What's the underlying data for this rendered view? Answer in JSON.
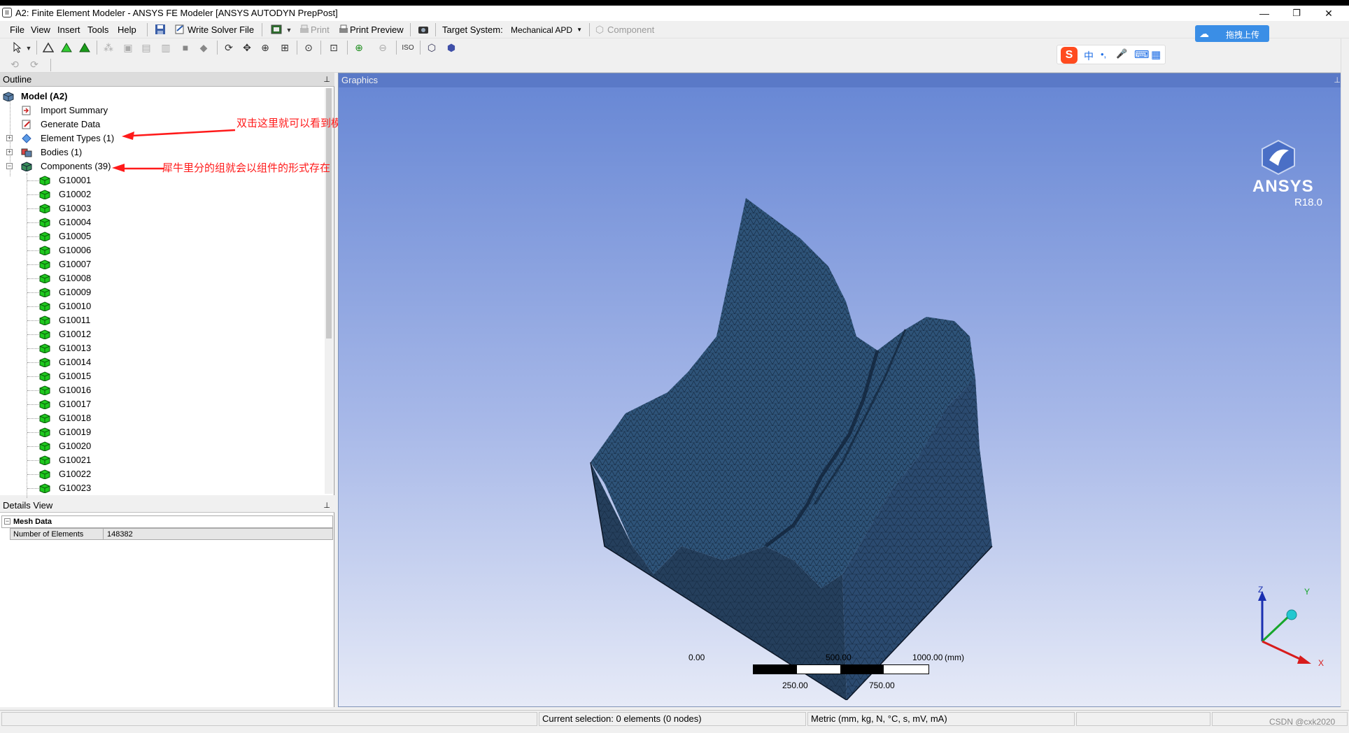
{
  "window": {
    "title": "A2: Finite Element Modeler - ANSYS FE Modeler [ANSYS AUTODYN PrepPost]",
    "app_icon": "ansys-app-icon",
    "minimize": "—",
    "restore": "❐",
    "close": "✕"
  },
  "menu": [
    "File",
    "View",
    "Insert",
    "Tools",
    "Help"
  ],
  "toolbar": {
    "write_solver_file": "Write Solver File",
    "print": "Print",
    "print_preview": "Print Preview",
    "target_system_label": "Target System:",
    "target_system_value": "Mechanical APD",
    "component": "Component"
  },
  "outline": {
    "title": "Outline",
    "pin": "⊥",
    "root": "Model (A2)",
    "items": [
      {
        "label": "Import Summary"
      },
      {
        "label": "Generate Data"
      },
      {
        "label": "Element Types (1)"
      },
      {
        "label": "Bodies (1)"
      },
      {
        "label": "Components (39)"
      }
    ],
    "components": [
      "G10001",
      "G10002",
      "G10003",
      "G10004",
      "G10005",
      "G10006",
      "G10007",
      "G10008",
      "G10009",
      "G10010",
      "G10011",
      "G10012",
      "G10013",
      "G10014",
      "G10015",
      "G10016",
      "G10017",
      "G10018",
      "G10019",
      "G10020",
      "G10021",
      "G10022",
      "G10023"
    ]
  },
  "annotations": {
    "element_types_note": "双击这里就可以看到模型",
    "components_note": "犀牛里分的组就会以组件的形式存在"
  },
  "details": {
    "title": "Details View",
    "pin": "⊥",
    "section": "Mesh Data",
    "rows": [
      {
        "name": "Number of Elements",
        "value": "148382"
      }
    ]
  },
  "graphics": {
    "title": "Graphics",
    "pin": "⊥",
    "logo_text": "ANSYS",
    "version": "R18.0",
    "scale": {
      "t0": "0.00",
      "t1": "500.00",
      "t2": "1000.00",
      "unit": "(mm)",
      "b1": "250.00",
      "b2": "750.00"
    },
    "axes": {
      "x": "X",
      "y": "Y",
      "z": "Z"
    }
  },
  "ime": {
    "s": "S",
    "zh": "中",
    "dot": "•,",
    "mic": "🎤",
    "kbd": "⌨",
    "grid": "▦"
  },
  "upload_button": "拖拽上传",
  "status": {
    "selection": "Current selection: 0 elements (0 nodes)",
    "units": "Metric (mm, kg, N, °C, s, mV, mA)",
    "watermark": "CSDN @cxk2020"
  },
  "colors": {
    "graphics_top": "#6686d4",
    "mesh": "#2b4a6f",
    "annotation": "#ff1a1a",
    "component_icon": "#1ec81e"
  }
}
